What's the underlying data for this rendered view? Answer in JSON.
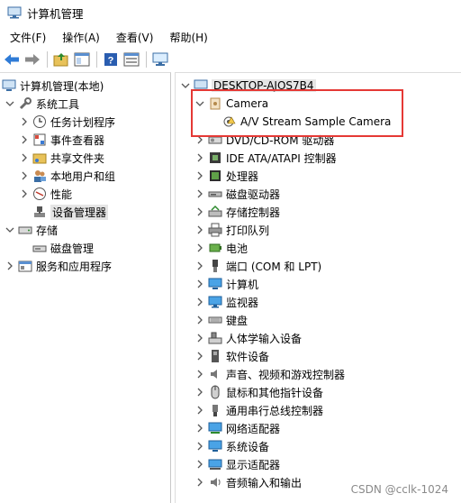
{
  "window": {
    "title": "计算机管理"
  },
  "menu": [
    "文件(F)",
    "操作(A)",
    "查看(V)",
    "帮助(H)"
  ],
  "left_tree": {
    "root": "计算机管理(本地)",
    "system_tools": "系统工具",
    "task_scheduler": "任务计划程序",
    "event_viewer": "事件查看器",
    "shared_folders": "共享文件夹",
    "local_users": "本地用户和组",
    "performance": "性能",
    "device_manager": "设备管理器",
    "storage": "存储",
    "disk_mgmt": "磁盘管理",
    "services_apps": "服务和应用程序"
  },
  "right_tree": {
    "root": "DESKTOP-AJOS7B4",
    "camera": "Camera",
    "camera_child": "A/V Stream Sample Camera",
    "categories": [
      "DVD/CD-ROM 驱动器",
      "IDE ATA/ATAPI 控制器",
      "处理器",
      "磁盘驱动器",
      "存储控制器",
      "打印队列",
      "电池",
      "端口 (COM 和 LPT)",
      "计算机",
      "监视器",
      "键盘",
      "人体学输入设备",
      "软件设备",
      "声音、视频和游戏控制器",
      "鼠标和其他指针设备",
      "通用串行总线控制器",
      "网络适配器",
      "系统设备",
      "显示适配器",
      "音频输入和输出"
    ]
  },
  "watermark": "CSDN @cclk-1024",
  "colors": {
    "highlight_border": "#e53935",
    "selection": "#e5e5e5"
  }
}
